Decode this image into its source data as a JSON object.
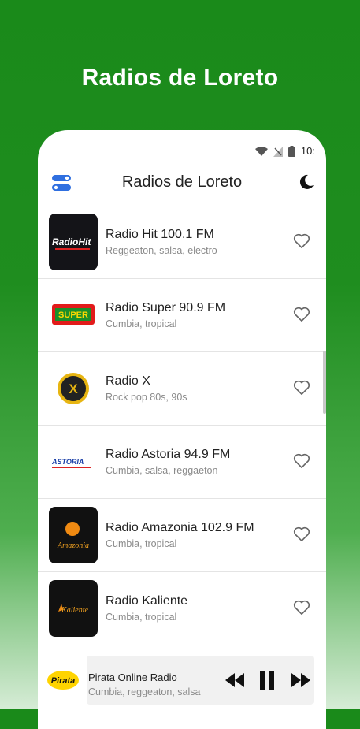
{
  "promo": {
    "title": "Radios de Loreto"
  },
  "status_bar": {
    "time": "10:"
  },
  "header": {
    "title": "Radios de Loreto"
  },
  "stations": [
    {
      "name": "Radio Hit 100.1 FM",
      "genres": "Reggeaton, salsa, electro",
      "logo_text": "RadioHit"
    },
    {
      "name": "Radio Super 90.9 FM",
      "genres": "Cumbia, tropical",
      "logo_text": "SUPER"
    },
    {
      "name": "Radio X",
      "genres": "Rock pop 80s, 90s",
      "logo_text": "X"
    },
    {
      "name": "Radio Astoria 94.9 FM",
      "genres": "Cumbia, salsa, reggaeton",
      "logo_text": "ASTORIA"
    },
    {
      "name": "Radio Amazonia 102.9 FM",
      "genres": "Cumbia, tropical",
      "logo_text": "Amazonia"
    },
    {
      "name": "Radio Kaliente",
      "genres": "Cumbia, tropical",
      "logo_text": "Kaliente"
    }
  ],
  "player": {
    "name": "Pirata Online Radio",
    "genres": "Cumbia, reggeaton, salsa",
    "logo_text": "Pirata"
  },
  "colors": {
    "brand_green": "#1a8a1a",
    "accent_blue": "#2f6fe0"
  }
}
